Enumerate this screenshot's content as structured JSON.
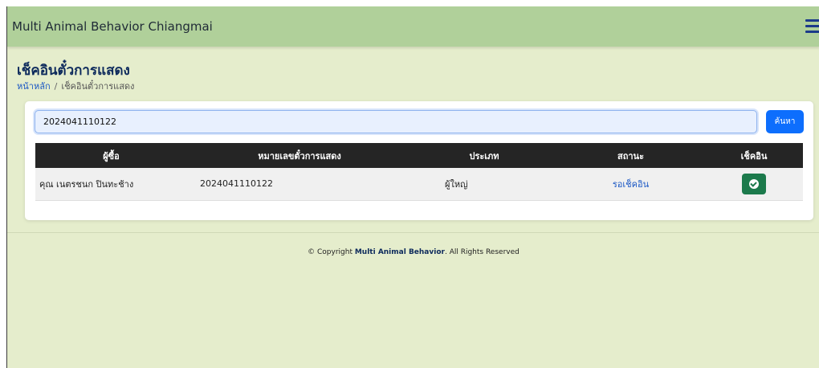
{
  "header": {
    "brand": "Multi Animal Behavior Chiangmai",
    "menu_icon": "hamburger-icon"
  },
  "page": {
    "title": "เช็คอินตั๋วการแสดง",
    "breadcrumb": {
      "home": "หน้าหลัก",
      "separator": "/",
      "current": "เช็คอินตั๋วการแสดง"
    }
  },
  "search": {
    "value": "2024041110122",
    "button_label": "ค้นหา"
  },
  "table": {
    "columns": [
      "ผู้ซื้อ",
      "หมายเลขตั๋วการแสดง",
      "ประเภท",
      "สถานะ",
      "เช็คอิน"
    ],
    "rows": [
      {
        "buyer": "คุณ เนตรชนก ปินทะช้าง",
        "ticket": "2024041110122",
        "type": "ผู้ใหญ่",
        "status": "รอเช็คอิน",
        "checkin_icon": "check-circle-icon"
      }
    ]
  },
  "footer": {
    "prefix": "© Copyright ",
    "brand": "Multi Animal Behavior",
    "suffix": ". All Rights Reserved"
  },
  "colors": {
    "topbar": "#b0d09a",
    "background": "#e5edcc",
    "primary": "#0d6efd",
    "success": "#1c7a4c",
    "table_header": "#252525"
  }
}
